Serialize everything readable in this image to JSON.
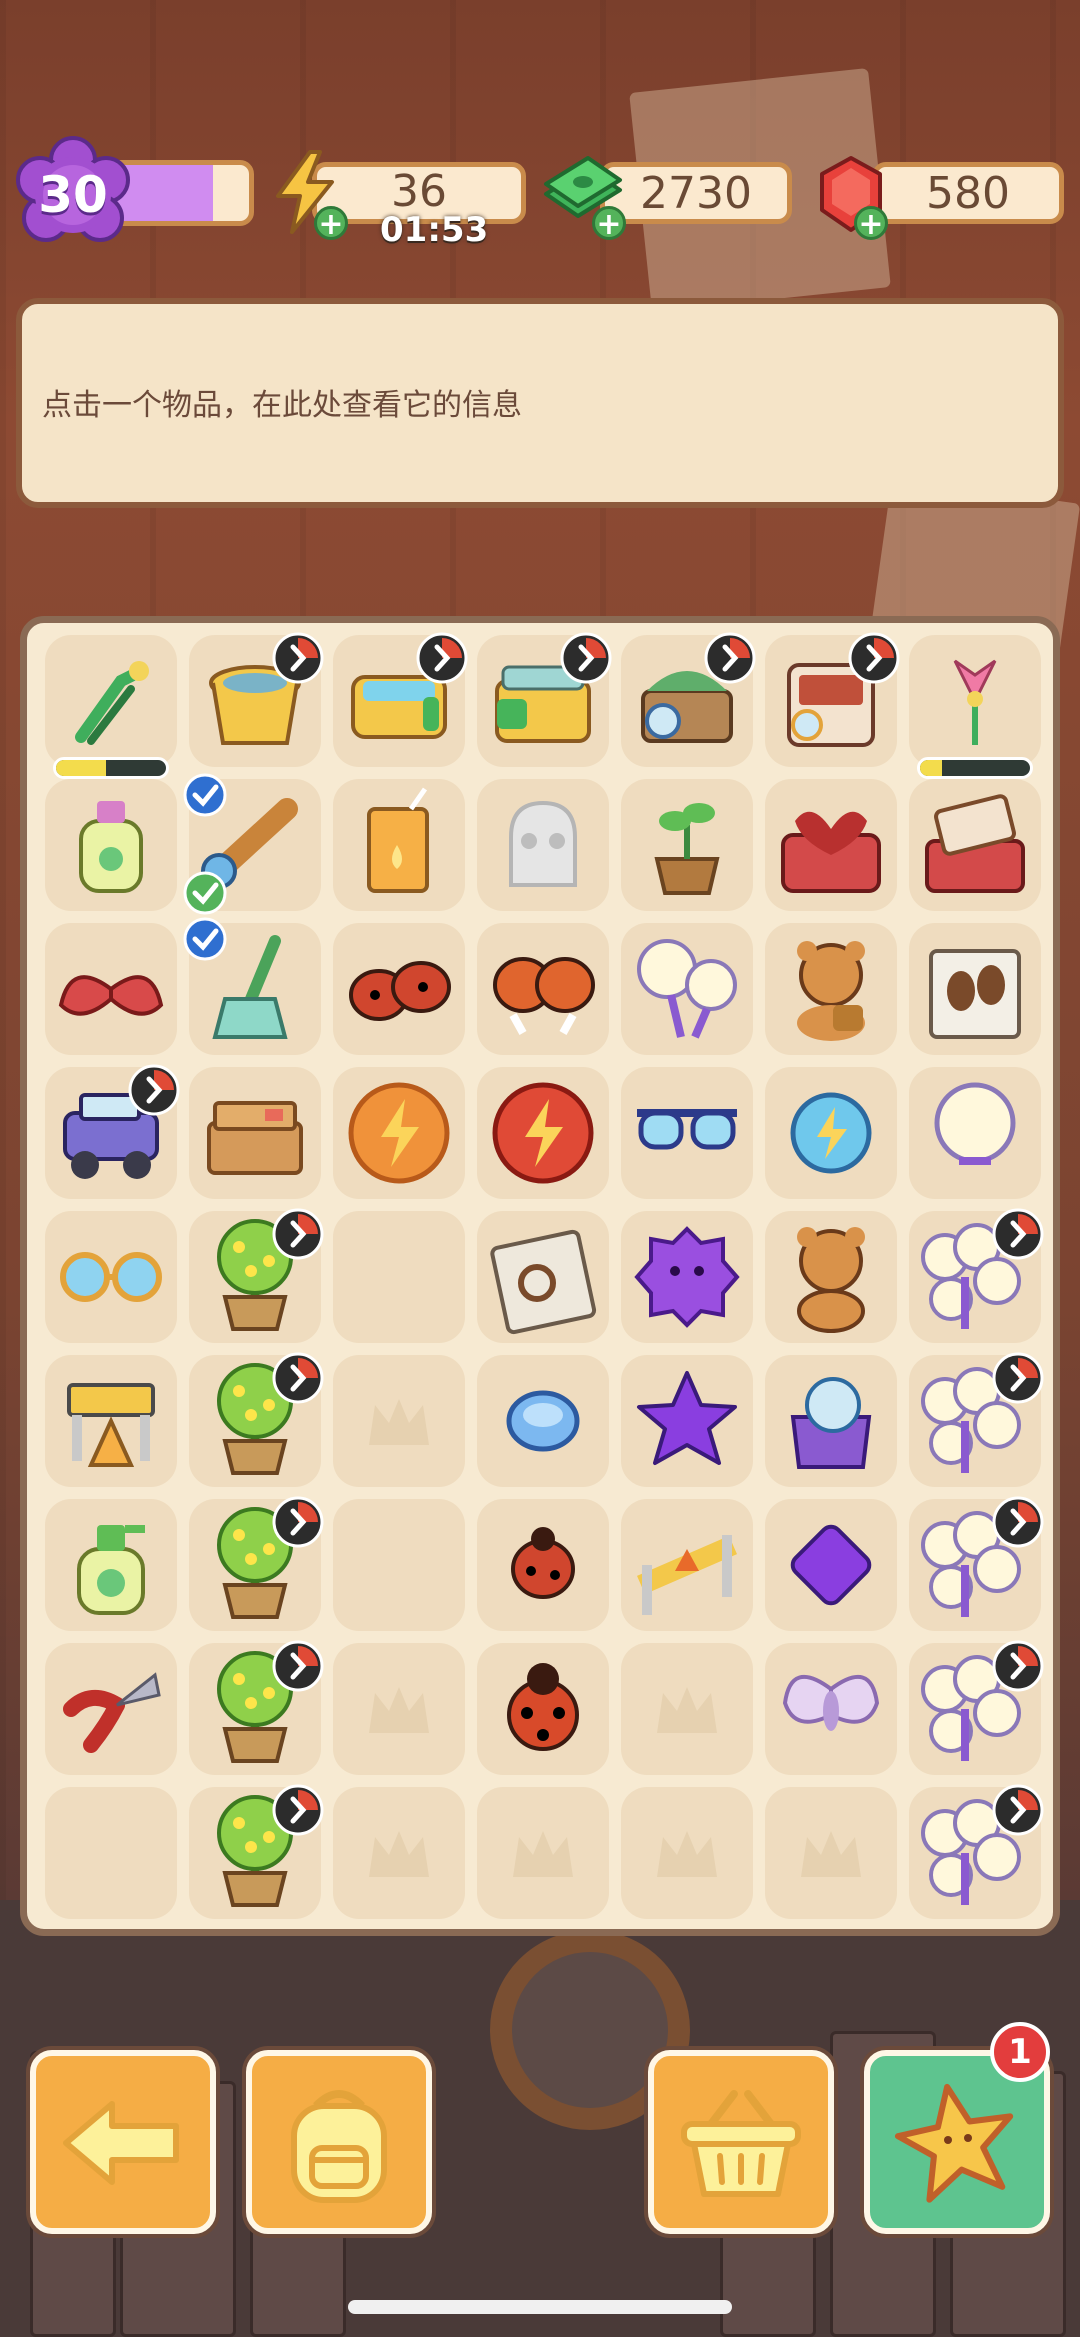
{
  "top_bar": {
    "level": "30",
    "level_progress": 0.75,
    "energy": "36",
    "energy_timer": "01:53",
    "cash": "2730",
    "gems": "580",
    "plus_symbol": "+"
  },
  "info_panel": {
    "text": "点击一个物品，在此处查看它的信息"
  },
  "board": {
    "rows": [
      [
        {
          "icon": "tweezers-icon",
          "progress": 0.45
        },
        {
          "icon": "bucket-generator-icon",
          "gen": true
        },
        {
          "icon": "bathtub-generator-icon",
          "gen": true
        },
        {
          "icon": "crate-generator-icon",
          "gen": true
        },
        {
          "icon": "terrarium-generator-icon",
          "gen": true
        },
        {
          "icon": "cabinet-generator-icon",
          "gen": true
        },
        {
          "icon": "flower-bloom-icon",
          "progress": 0.2
        }
      ],
      [
        {
          "icon": "lotion-bottle-icon"
        },
        {
          "icon": "telescope-icon",
          "checks": true
        },
        {
          "icon": "juice-box-icon"
        },
        {
          "icon": "ghost-skull-icon"
        },
        {
          "icon": "potted-sprout-icon"
        },
        {
          "icon": "heart-chest-icon"
        },
        {
          "icon": "toolbox-open-icon"
        }
      ],
      [
        {
          "icon": "feather-wings-icon"
        },
        {
          "icon": "broom-icon",
          "check": true
        },
        {
          "icon": "ladybugs-pair-icon"
        },
        {
          "icon": "ladybugs-flying-icon"
        },
        {
          "icon": "dandelion-pair-icon"
        },
        {
          "icon": "teddy-honey-icon"
        },
        {
          "icon": "evidence-bag-footprints-icon"
        }
      ],
      [
        {
          "icon": "jeep-icon",
          "gen": true
        },
        {
          "icon": "cardboard-boxes-icon"
        },
        {
          "icon": "energy-orb-orange-icon"
        },
        {
          "icon": "energy-orb-red-icon"
        },
        {
          "icon": "sunglasses-icon"
        },
        {
          "icon": "energy-orb-blue-icon"
        },
        {
          "icon": "dandelion-single-icon"
        }
      ],
      [
        {
          "icon": "goggles-icon"
        },
        {
          "icon": "flower-tree-icon",
          "gen": true
        },
        {
          "icon": ""
        },
        {
          "icon": "evidence-bag-magnifier-icon"
        },
        {
          "icon": "purple-blob-icon"
        },
        {
          "icon": "teddy-bear-icon"
        },
        {
          "icon": "dandelion-bunch-icon",
          "gen": true
        }
      ],
      [
        {
          "icon": "barrier-cones-icon"
        },
        {
          "icon": "flower-tree-icon",
          "gen": true
        },
        {
          "icon": "crown-slot-icon"
        },
        {
          "icon": "blue-gem-disc-icon"
        },
        {
          "icon": "purple-star-icon"
        },
        {
          "icon": "crystal-ball-box-icon"
        },
        {
          "icon": "dandelion-bunch-icon",
          "gen": true
        }
      ],
      [
        {
          "icon": "lotion-pump-icon"
        },
        {
          "icon": "flower-tree-icon",
          "gen": true
        },
        {
          "icon": ""
        },
        {
          "icon": "ladybug-small-icon"
        },
        {
          "icon": "caution-barrier-icon"
        },
        {
          "icon": "purple-diamond-icon"
        },
        {
          "icon": "dandelion-bunch-icon",
          "gen": true
        }
      ],
      [
        {
          "icon": "pruning-shears-icon"
        },
        {
          "icon": "flower-tree-icon",
          "gen": true
        },
        {
          "icon": "crown-slot-icon"
        },
        {
          "icon": "ladybug-icon"
        },
        {
          "icon": "crown-slot-icon"
        },
        {
          "icon": "moth-icon"
        },
        {
          "icon": "dandelion-bunch-icon",
          "gen": true
        }
      ],
      [
        {
          "icon": ""
        },
        {
          "icon": "flower-tree-icon",
          "gen": true
        },
        {
          "icon": "crown-slot-icon"
        },
        {
          "icon": "crown-slot-icon"
        },
        {
          "icon": "crown-slot-icon"
        },
        {
          "icon": "crown-slot-icon"
        },
        {
          "icon": "dandelion-bunch-icon",
          "gen": true
        }
      ]
    ]
  },
  "bottom_bar": {
    "notification_count": "1",
    "buttons": [
      "back-arrow-icon",
      "backpack-icon",
      "basket-icon",
      "star-icon"
    ]
  },
  "colors": {
    "accent_orange": "#f5ad45",
    "accent_green": "#5ec48f",
    "level_purple": "#c062e0",
    "panel_border": "#8c5a3c"
  }
}
